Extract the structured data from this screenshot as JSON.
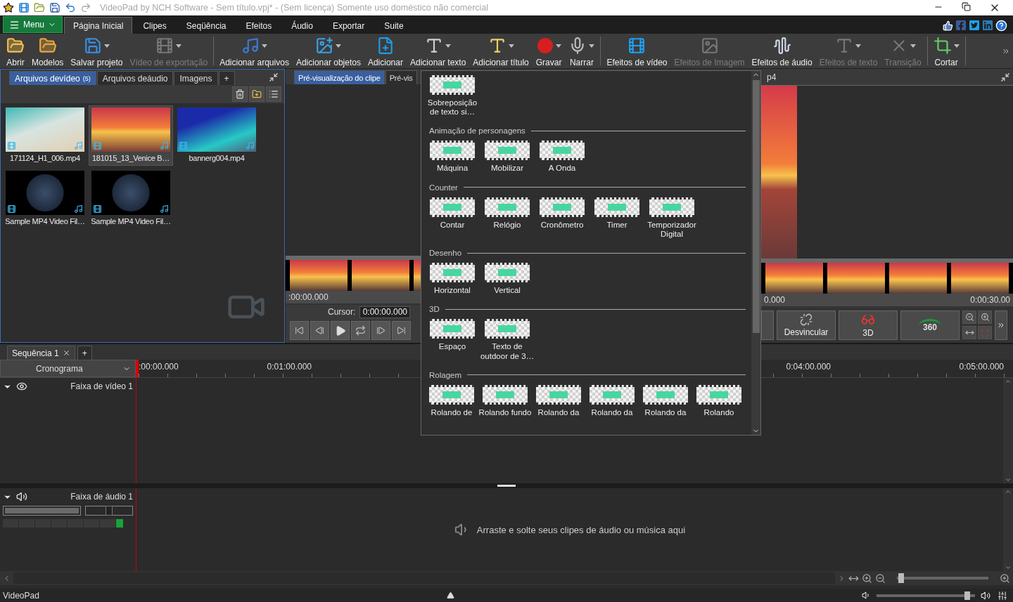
{
  "title_bar": {
    "title": "VideoPad by NCH Software - Sem título.vpj* - (Sem licença) Somente uso doméstico não comercial"
  },
  "menu_button": {
    "label": "Menu"
  },
  "menu_tabs": [
    {
      "label": "Página Inicial",
      "selected": true
    },
    {
      "label": "Clipes",
      "selected": false
    },
    {
      "label": "Seqüência",
      "selected": false
    },
    {
      "label": "Efeitos",
      "selected": false
    },
    {
      "label": "Áudio",
      "selected": false
    },
    {
      "label": "Exportar",
      "selected": false
    },
    {
      "label": "Suite",
      "selected": false
    }
  ],
  "toolbar": [
    {
      "label": "Abrir",
      "disabled": false,
      "has_menu": false
    },
    {
      "label": "Modelos",
      "disabled": false,
      "has_menu": false
    },
    {
      "label": "Salvar projeto",
      "disabled": false,
      "has_menu": true
    },
    {
      "label": "Vídeo de exportação",
      "disabled": true,
      "has_menu": true
    },
    {
      "label": "Adicionar arquivos",
      "disabled": false,
      "has_menu": true
    },
    {
      "label": "Adicionar objetos",
      "disabled": false,
      "has_menu": true
    },
    {
      "label": "Adicionar",
      "disabled": false,
      "has_menu": false
    },
    {
      "label": "Adicionar texto",
      "disabled": false,
      "has_menu": true
    },
    {
      "label": "Adicionar título",
      "disabled": false,
      "has_menu": true
    },
    {
      "label": "Gravar",
      "disabled": false,
      "has_menu": true
    },
    {
      "label": "Narrar",
      "disabled": false,
      "has_menu": true
    },
    {
      "label": "Efeitos de vídeo",
      "disabled": false,
      "has_menu": false
    },
    {
      "label": "Efeitos de Imagem",
      "disabled": true,
      "has_menu": false
    },
    {
      "label": "Efeitos de áudio",
      "disabled": false,
      "has_menu": false
    },
    {
      "label": "Efeitos de texto",
      "disabled": true,
      "has_menu": true
    },
    {
      "label": "Transição",
      "disabled": true,
      "has_menu": true
    },
    {
      "label": "Cortar",
      "disabled": false,
      "has_menu": true
    }
  ],
  "file_panel": {
    "tabs": [
      {
        "label": "Arquivos devídeo",
        "count": "(5)",
        "selected": true
      },
      {
        "label": "Arquivos deáudio",
        "selected": false
      },
      {
        "label": "Imagens",
        "selected": false
      },
      {
        "label": "+",
        "selected": false
      }
    ],
    "files": [
      {
        "name": "171124_H1_006.mp4",
        "kind": "beach",
        "selected": false
      },
      {
        "name": "181015_13_Venice B…",
        "kind": "sunset",
        "selected": true
      },
      {
        "name": "bannerg004.mp4",
        "kind": "reef",
        "selected": false
      },
      {
        "name": "Sample MP4 Video Fil…",
        "kind": "earth",
        "selected": false
      },
      {
        "name": "Sample MP4 Video Fil…",
        "kind": "earth",
        "selected": false
      }
    ]
  },
  "clip_preview": {
    "tabs": [
      {
        "label": "Pré-visualização do clipe",
        "selected": true
      },
      {
        "label": "Pré-vis",
        "selected": false
      }
    ],
    "time": ":00:00.000",
    "cursor_label": "Cursor:",
    "cursor_value": "0:00:00.000"
  },
  "sequence_preview": {
    "title": "p4",
    "time_start": "0.000",
    "time_end": "0:00:30.00",
    "buttons": [
      "Desvincular",
      "3D",
      "360"
    ]
  },
  "effects_menu": {
    "items": [
      "Sobreposição de texto si…"
    ],
    "sections": [
      {
        "title": "Animação de personagens",
        "items": [
          "Máquina",
          "Mobilizar",
          "A Onda"
        ]
      },
      {
        "title": "Counter",
        "items": [
          "Contar",
          "Relógio",
          "Cronômetro",
          "Timer",
          "Temporizador Digital"
        ]
      },
      {
        "title": "Desenho",
        "items": [
          "Horizontal",
          "Vertical"
        ]
      },
      {
        "title": "3D",
        "items": [
          "Espaço",
          "Texto de outdoor de 3…"
        ]
      },
      {
        "title": "Rolagem",
        "items": [
          "Rolando de",
          "Rolando fundo",
          "Rolando da",
          "Rolando da",
          "Rolando da",
          "Rolando"
        ]
      }
    ]
  },
  "timeline": {
    "tabs": [
      {
        "label": "Sequência 1",
        "selected": true
      },
      {
        "label": "+",
        "selected": false
      }
    ],
    "mode": "Cronograma",
    "ruler": [
      ":00:00.000",
      "0:01:00.000",
      "0:04:00.000",
      "0:05:00.000"
    ],
    "video_track": {
      "name": "Faixa de vídeo 1"
    },
    "audio_track": {
      "name": "Faixa de áudio 1",
      "volume": {
        "level": 1
      },
      "pan": {
        "level": 0.5
      },
      "drop_hint": "Arraste e solte seus clipes de áudio ou música aqui"
    },
    "zoom": {
      "level": 0.02
    }
  },
  "status_bar": {
    "app": "VideoPad",
    "volume": {
      "level": 0.95
    }
  }
}
